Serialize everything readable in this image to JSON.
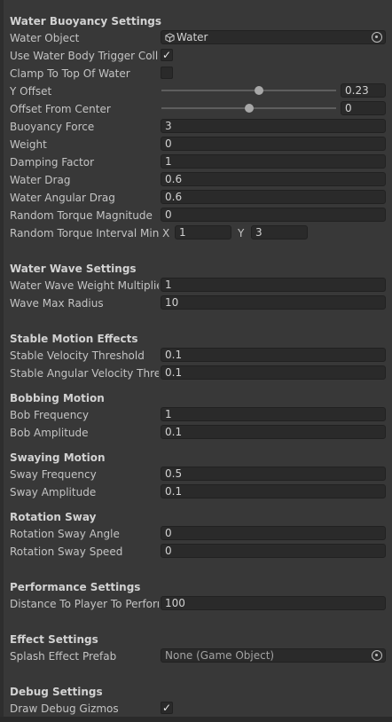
{
  "buoyancy": {
    "header": "Water Buoyancy Settings",
    "water_object": {
      "label": "Water Object",
      "value": "Water",
      "icon": "cube-icon"
    },
    "use_trigger": {
      "label": "Use Water Body Trigger Collider",
      "checked": true,
      "mark": "✓"
    },
    "clamp_top": {
      "label": "Clamp To Top Of Water",
      "checked": false,
      "mark": ""
    },
    "y_offset": {
      "label": "Y Offset",
      "value": "0.23",
      "slider_fraction": 0.56
    },
    "offset_center": {
      "label": "Offset From Center",
      "value": "0",
      "slider_fraction": 0.5
    },
    "buoyancy_force": {
      "label": "Buoyancy Force",
      "value": "3"
    },
    "weight": {
      "label": "Weight",
      "value": "0"
    },
    "damping": {
      "label": "Damping Factor",
      "value": "1"
    },
    "water_drag": {
      "label": "Water Drag",
      "value": "0.6"
    },
    "angular_drag": {
      "label": "Water Angular Drag",
      "value": "0.6"
    },
    "torque_mag": {
      "label": "Random Torque Magnitude",
      "value": "0"
    },
    "torque_interval": {
      "label": "Random Torque Interval Min Max",
      "x_label": "X",
      "x_value": "1",
      "y_label": "Y",
      "y_value": "3"
    }
  },
  "wave": {
    "header": "Water Wave Settings",
    "weight_mult": {
      "label": "Water Wave Weight Multiplier",
      "value": "1"
    },
    "max_radius": {
      "label": "Wave Max Radius",
      "value": "10"
    }
  },
  "stable": {
    "header": "Stable Motion Effects",
    "velocity": {
      "label": "Stable Velocity Threshold",
      "value": "0.1"
    },
    "angular": {
      "label": "Stable Angular Velocity Threshold",
      "value": "0.1"
    }
  },
  "bobbing": {
    "header": "Bobbing Motion",
    "frequency": {
      "label": "Bob Frequency",
      "value": "1"
    },
    "amplitude": {
      "label": "Bob Amplitude",
      "value": "0.1"
    }
  },
  "swaying": {
    "header": "Swaying Motion",
    "frequency": {
      "label": "Sway Frequency",
      "value": "0.5"
    },
    "amplitude": {
      "label": "Sway Amplitude",
      "value": "0.1"
    }
  },
  "rotation": {
    "header": "Rotation Sway",
    "angle": {
      "label": "Rotation Sway Angle",
      "value": "0"
    },
    "speed": {
      "label": "Rotation Sway Speed",
      "value": "0"
    }
  },
  "performance": {
    "header": "Performance Settings",
    "distance": {
      "label": "Distance To Player To Perform Updates",
      "value": "100"
    }
  },
  "effects": {
    "header": "Effect Settings",
    "splash": {
      "label": "Splash Effect Prefab",
      "value": "None (Game Object)"
    }
  },
  "debug": {
    "header": "Debug Settings",
    "gizmos": {
      "label": "Draw Debug Gizmos",
      "checked": true,
      "mark": "✓"
    }
  },
  "colors": {
    "background": "#383838",
    "field": "#2a2a2a",
    "text": "#c4c4c4"
  }
}
